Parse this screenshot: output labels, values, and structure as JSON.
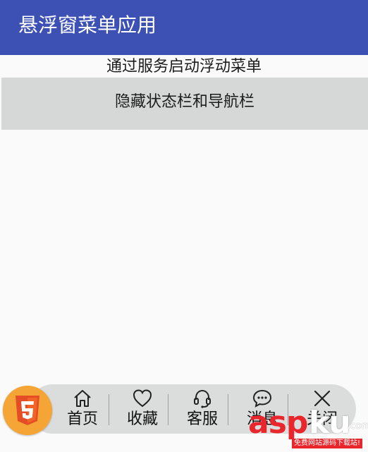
{
  "app_bar": {
    "title": "悬浮窗菜单应用",
    "color": "#3d51b5"
  },
  "buttons": {
    "start_service": "通过服务启动浮动菜单",
    "hide_bars": "隐藏状态栏和导航栏"
  },
  "float_menu": {
    "logo_icon": "html5-logo-icon",
    "items": [
      {
        "label": "首页",
        "icon": "home-icon"
      },
      {
        "label": "收藏",
        "icon": "heart-icon"
      },
      {
        "label": "客服",
        "icon": "headset-icon"
      },
      {
        "label": "消息",
        "icon": "chat-bubble-icon"
      },
      {
        "label": "关闭",
        "icon": "close-icon"
      }
    ]
  },
  "watermark": {
    "brand_a": "asp",
    "brand_b": "ku",
    "domain": ".com",
    "slogan": "免费网站源码下载站!"
  }
}
